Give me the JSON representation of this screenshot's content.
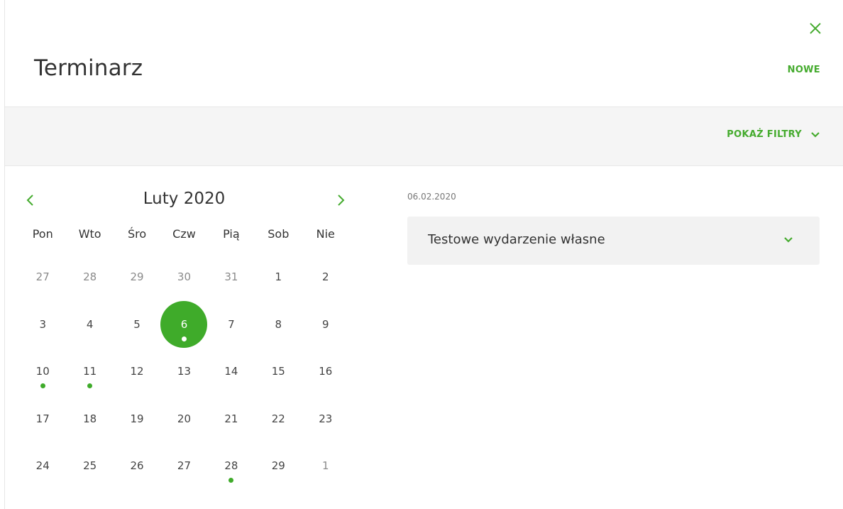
{
  "header": {
    "title": "Terminarz",
    "new_label": "NOWE",
    "close_icon": "close-icon"
  },
  "filters": {
    "toggle_label": "POKAŻ FILTRY",
    "icon": "chevron-down-icon"
  },
  "calendar": {
    "month_label": "Luty 2020",
    "weekdays": [
      "Pon",
      "Wto",
      "Śro",
      "Czw",
      "Pią",
      "Sob",
      "Nie"
    ],
    "weeks": [
      [
        {
          "d": "27",
          "other": true
        },
        {
          "d": "28",
          "other": true
        },
        {
          "d": "29",
          "other": true
        },
        {
          "d": "30",
          "other": true
        },
        {
          "d": "31",
          "other": true
        },
        {
          "d": "1"
        },
        {
          "d": "2"
        }
      ],
      [
        {
          "d": "3"
        },
        {
          "d": "4"
        },
        {
          "d": "5"
        },
        {
          "d": "6",
          "selected": true,
          "event": true
        },
        {
          "d": "7"
        },
        {
          "d": "8"
        },
        {
          "d": "9"
        }
      ],
      [
        {
          "d": "10",
          "event": true
        },
        {
          "d": "11",
          "event": true
        },
        {
          "d": "12"
        },
        {
          "d": "13"
        },
        {
          "d": "14"
        },
        {
          "d": "15"
        },
        {
          "d": "16"
        }
      ],
      [
        {
          "d": "17"
        },
        {
          "d": "18"
        },
        {
          "d": "19"
        },
        {
          "d": "20"
        },
        {
          "d": "21"
        },
        {
          "d": "22"
        },
        {
          "d": "23"
        }
      ],
      [
        {
          "d": "24"
        },
        {
          "d": "25"
        },
        {
          "d": "26"
        },
        {
          "d": "27"
        },
        {
          "d": "28",
          "event": true
        },
        {
          "d": "29"
        },
        {
          "d": "1",
          "other": true
        }
      ]
    ]
  },
  "events_panel": {
    "date": "06.02.2020",
    "events": [
      {
        "title": "Testowe wydarzenie własne"
      }
    ]
  },
  "colors": {
    "accent": "#45ab2e",
    "selected_day": "#3fab2a",
    "filter_bar": "#f5f5f5",
    "event_card": "#f2f2f2"
  }
}
